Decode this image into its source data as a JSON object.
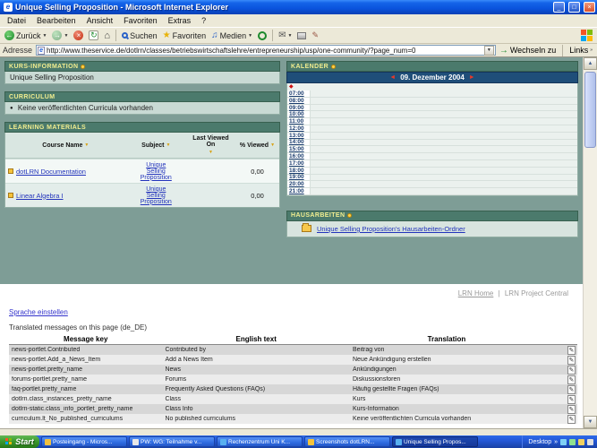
{
  "window": {
    "title": "Unique Selling Proposition - Microsoft Internet Explorer",
    "menu_items": [
      "Datei",
      "Bearbeiten",
      "Ansicht",
      "Favoriten",
      "Extras",
      "?"
    ],
    "toolbar": {
      "back_label": "Zurück",
      "search_label": "Suchen",
      "favorites_label": "Favoriten",
      "media_label": "Medien"
    },
    "address": {
      "label": "Adresse",
      "url": "http://www.theservice.de/dotlrn/classes/betriebswirtschaftslehre/entrepreneurship/usp/one-community/?page_num=0",
      "go_label": "Wechseln zu",
      "links_label": "Links"
    }
  },
  "portlets": {
    "course_info": {
      "title": "KURS-INFORMATION",
      "content": "Unique Selling Proposition"
    },
    "curriculum": {
      "title": "CURRICULUM",
      "content": "Keine veröffentlichten Curricula vorhanden"
    },
    "learning_materials": {
      "title": "LEARNING MATERIALS",
      "columns": [
        "Course Name",
        "Subject",
        "Last Viewed On",
        "% Viewed"
      ],
      "rows": [
        {
          "course": "dotLRN Documentation",
          "subject": "Unique Selling Proposition",
          "last_viewed": "",
          "viewed": "0,00"
        },
        {
          "course": "Linear Algebra I",
          "subject": "Unique Selling Proposition",
          "last_viewed": "",
          "viewed": "0,00"
        }
      ]
    },
    "calendar": {
      "title": "KALENDER",
      "date": "09. Dezember 2004",
      "times": [
        "07:00",
        "08:00",
        "09:00",
        "10:00",
        "11:00",
        "12:00",
        "13:00",
        "14:00",
        "15:00",
        "16:00",
        "17:00",
        "18:00",
        "19:00",
        "20:00",
        "21:00"
      ]
    },
    "homework": {
      "title": "HAUSARBEITEN",
      "link": "Unique Selling Proposition's Hausarbeiten-Ordner"
    }
  },
  "footer": {
    "lrn_home": "LRN Home",
    "lrn_separator": "|",
    "lrn_project_central": "LRN Project Central",
    "language_link": "Sprache einstellen",
    "translated_heading": "Translated messages on this page (de_DE)",
    "table": {
      "columns": [
        "Message key",
        "English text",
        "Translation"
      ],
      "rows": [
        {
          "key": "news-portlet.Contributed",
          "english": "Contributed by",
          "german": "Beitrag von"
        },
        {
          "key": "news-portlet.Add_a_News_Item",
          "english": "Add a News Item",
          "german": "Neue Ankündigung erstellen"
        },
        {
          "key": "news-portlet.pretty_name",
          "english": "News",
          "german": "Ankündigungen"
        },
        {
          "key": "forums-portlet.pretty_name",
          "english": "Forums",
          "german": "Diskussionsforen"
        },
        {
          "key": "faq-portlet.pretty_name",
          "english": "Frequently Asked Questions (FAQs)",
          "german": "Häufig gestellte Fragen (FAQs)"
        },
        {
          "key": "dotlrn.class_instances_pretty_name",
          "english": "Class",
          "german": "Kurs"
        },
        {
          "key": "dotlrn-static.class_info_portlet_pretty_name",
          "english": "Class Info",
          "german": "Kurs-Information"
        },
        {
          "key": "curriculum.lt_No_published_curriculums",
          "english": "No published curriculums",
          "german": "Keine veröffentlichten Curricula vorhanden"
        }
      ]
    }
  },
  "taskbar": {
    "start_label": "Start",
    "buttons": [
      {
        "label": "Posteingang - Micros..."
      },
      {
        "label": "PW: WG: Teilnahme v..."
      },
      {
        "label": "Rechenzentrum Uni K..."
      },
      {
        "label": "Screenshots dotLRN..."
      },
      {
        "label": "Unique Selling Propos..."
      }
    ],
    "desktop_label": "Desktop"
  },
  "icons": {
    "ie_logo": "e",
    "minimize": "_",
    "maximize": "□",
    "close": "×",
    "back_arrow": "←",
    "forward_arrow": "→",
    "stop": "×",
    "refresh": "↻",
    "home": "⌂",
    "favorites_star": "★",
    "media_note": "♫",
    "mail_envelope": "✉",
    "pencil": "✎",
    "dropdown_caret": "▼",
    "go_arrow": "→",
    "links_chevron": "»",
    "scroll_up": "▲",
    "scroll_down": "▼",
    "sort_marker": "▼",
    "nav_left": "◄",
    "nav_right": "►",
    "legend_diamond": "◆",
    "bullet": "●",
    "edit_pencil": "✎",
    "desktop_chevron": "»"
  }
}
